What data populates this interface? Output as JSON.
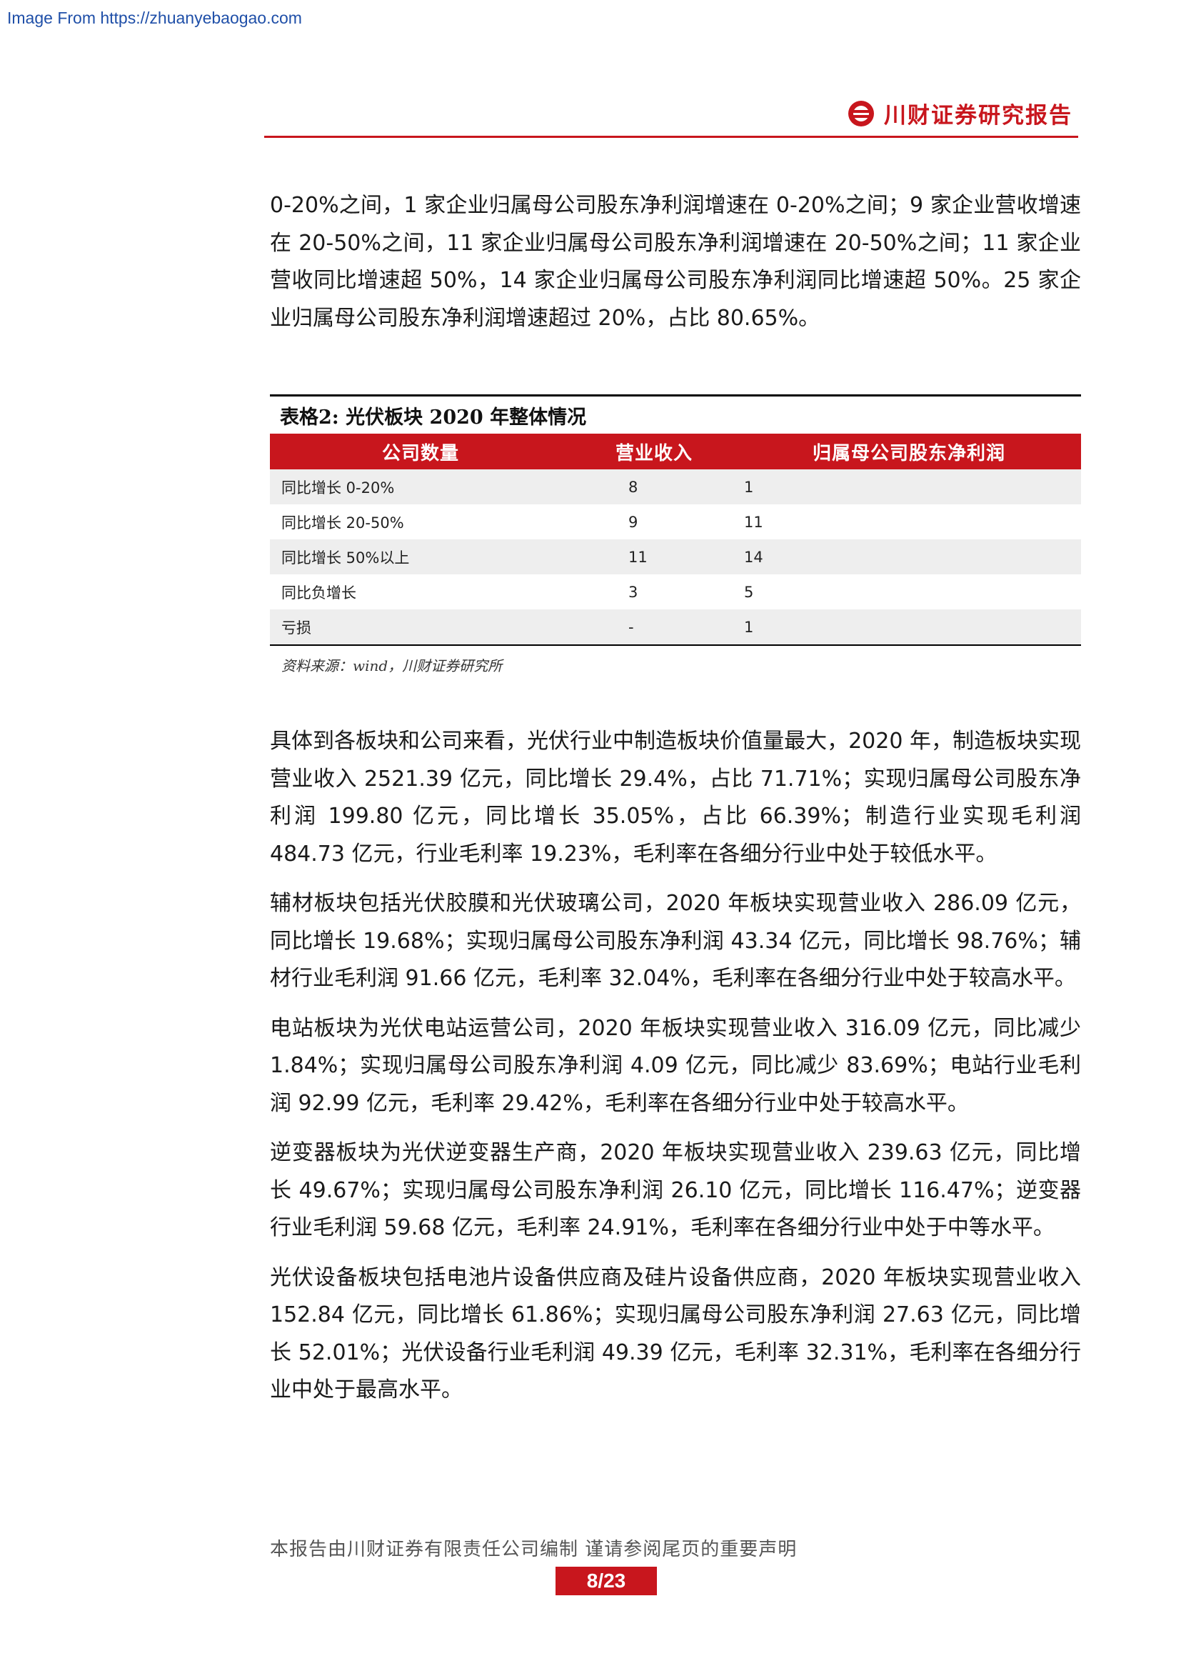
{
  "watermark": "Image From https://zhuanyebaogao.com",
  "header": {
    "brand": "川财证券研究报告"
  },
  "intro_paragraph": "0-20%之间，1 家企业归属母公司股东净利润增速在 0-20%之间；9 家企业营收增速在 20-50%之间，11 家企业归属母公司股东净利润增速在 20-50%之间；11 家企业营收同比增速超 50%，14 家企业归属母公司股东净利润同比增速超 50%。25 家企业归属母公司股东净利润增速超过 20%，占比 80.65%。",
  "table": {
    "title": "表格2:  光伏板块 2020 年整体情况",
    "headers": [
      "公司数量",
      "营业收入",
      "归属母公司股东净利润"
    ],
    "rows": [
      [
        "同比增长 0-20%",
        "8",
        "1"
      ],
      [
        "同比增长 20-50%",
        "9",
        "11"
      ],
      [
        "同比增长 50%以上",
        "11",
        "14"
      ],
      [
        "同比负增长",
        "3",
        "5"
      ],
      [
        "亏损",
        "-",
        "1"
      ]
    ],
    "source": "资料来源：wind，川财证券研究所"
  },
  "paragraphs": [
    "具体到各板块和公司来看，光伏行业中制造板块价值量最大，2020 年，制造板块实现营业收入 2521.39 亿元，同比增长 29.4%，占比 71.71%；实现归属母公司股东净利润 199.80 亿元，同比增长 35.05%，占比 66.39%；制造行业实现毛利润 484.73 亿元，行业毛利率 19.23%，毛利率在各细分行业中处于较低水平。",
    "辅材板块包括光伏胶膜和光伏玻璃公司，2020 年板块实现营业收入 286.09 亿元，同比增长 19.68%；实现归属母公司股东净利润 43.34 亿元，同比增长 98.76%；辅材行业毛利润 91.66 亿元，毛利率 32.04%，毛利率在各细分行业中处于较高水平。",
    "电站板块为光伏电站运营公司，2020 年板块实现营业收入 316.09 亿元，同比减少 1.84%；实现归属母公司股东净利润 4.09 亿元，同比减少 83.69%；电站行业毛利润 92.99 亿元，毛利率 29.42%，毛利率在各细分行业中处于较高水平。",
    "逆变器板块为光伏逆变器生产商，2020 年板块实现营业收入 239.63 亿元，同比增长 49.67%；实现归属母公司股东净利润 26.10 亿元，同比增长 116.47%；逆变器行业毛利润 59.68 亿元，毛利率 24.91%，毛利率在各细分行业中处于中等水平。",
    "光伏设备板块包括电池片设备供应商及硅片设备供应商，2020 年板块实现营业收入 152.84 亿元，同比增长 61.86%；实现归属母公司股东净利润 27.63 亿元，同比增长 52.01%；光伏设备行业毛利润 49.39 亿元，毛利率 32.31%，毛利率在各细分行业中处于最高水平。"
  ],
  "footer": {
    "disclaimer": "本报告由川财证券有限责任公司编制  谨请参阅尾页的重要声明",
    "page": "8/23"
  },
  "colors": {
    "accent": "#c8161d",
    "watermark": "#1f4fa8"
  }
}
